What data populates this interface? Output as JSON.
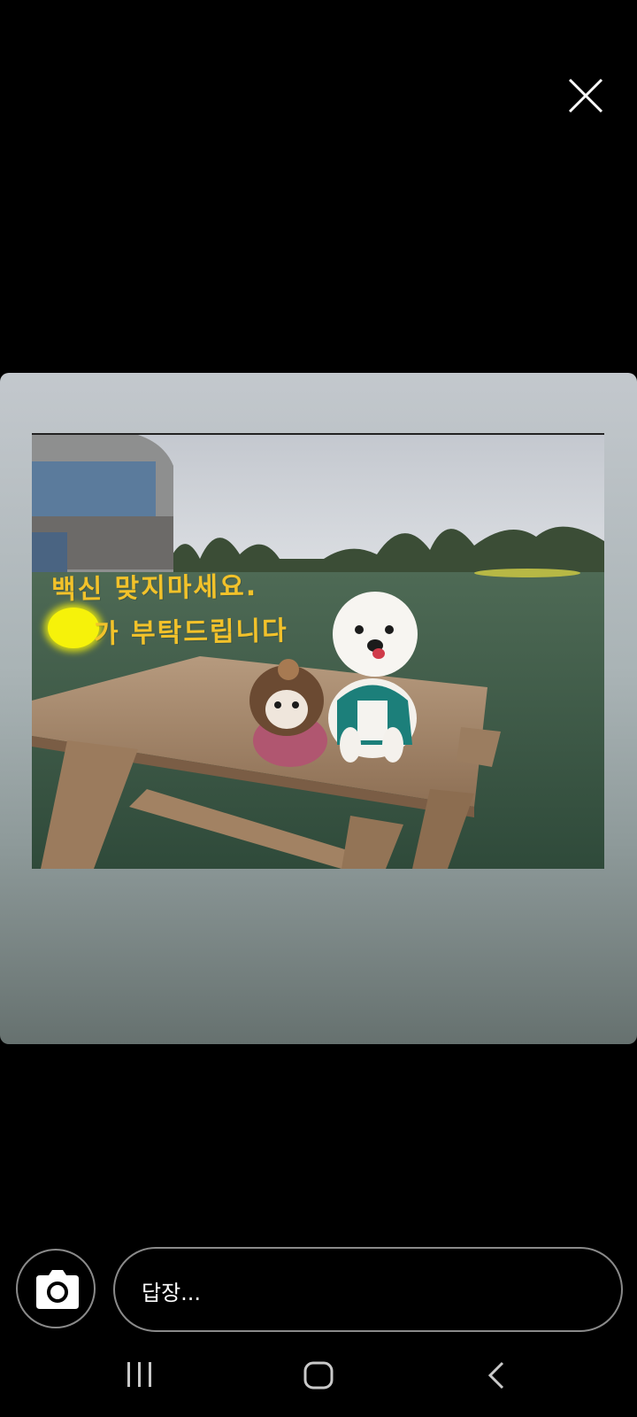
{
  "viewer": {
    "close_icon": "close-icon"
  },
  "story": {
    "overlay_line1": "백신 맞지마세요.",
    "overlay_line2": "가 부탁드립니다",
    "colors": {
      "overlay_text": "#f2c22a",
      "blot": "#f6f20a"
    }
  },
  "reply_bar": {
    "camera_icon": "camera-icon",
    "placeholder": "답장..."
  },
  "navbar": {
    "recents_icon": "recents-icon",
    "home_icon": "home-icon",
    "back_icon": "back-icon"
  }
}
